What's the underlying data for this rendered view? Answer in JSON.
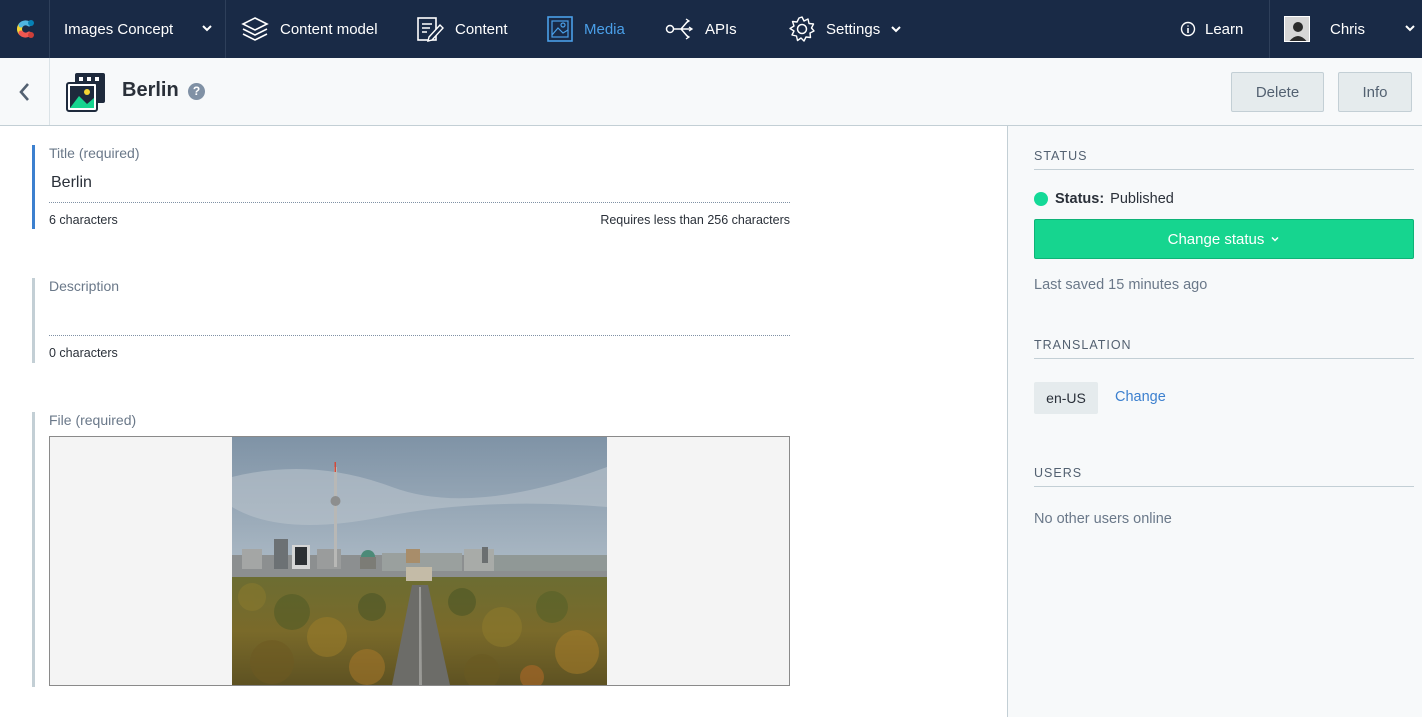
{
  "nav": {
    "space": "Images Concept",
    "items": [
      {
        "label": "Content model"
      },
      {
        "label": "Content"
      },
      {
        "label": "Media"
      },
      {
        "label": "APIs"
      },
      {
        "label": "Settings"
      }
    ],
    "learn": "Learn",
    "user": "Chris",
    "active_color": "#4a9fe8"
  },
  "entity": {
    "title": "Berlin",
    "help": "?",
    "delete_label": "Delete",
    "info_label": "Info"
  },
  "fields": {
    "title": {
      "label": "Title (required)",
      "value": "Berlin",
      "count": "6 characters",
      "limit": "Requires less than 256 characters"
    },
    "description": {
      "label": "Description",
      "value": "",
      "count": "0 characters"
    },
    "file": {
      "label": "File (required)"
    }
  },
  "sidebar": {
    "status_heading": "STATUS",
    "status_label": "Status:",
    "status_value": "Published",
    "change_status": "Change status",
    "last_saved": "Last saved 15 minutes ago",
    "translation_heading": "TRANSLATION",
    "locale": "en-US",
    "change_locale": "Change",
    "users_heading": "USERS",
    "users_text": "No other users online",
    "status_color": "#14d997",
    "button_color": "#16d58f"
  }
}
